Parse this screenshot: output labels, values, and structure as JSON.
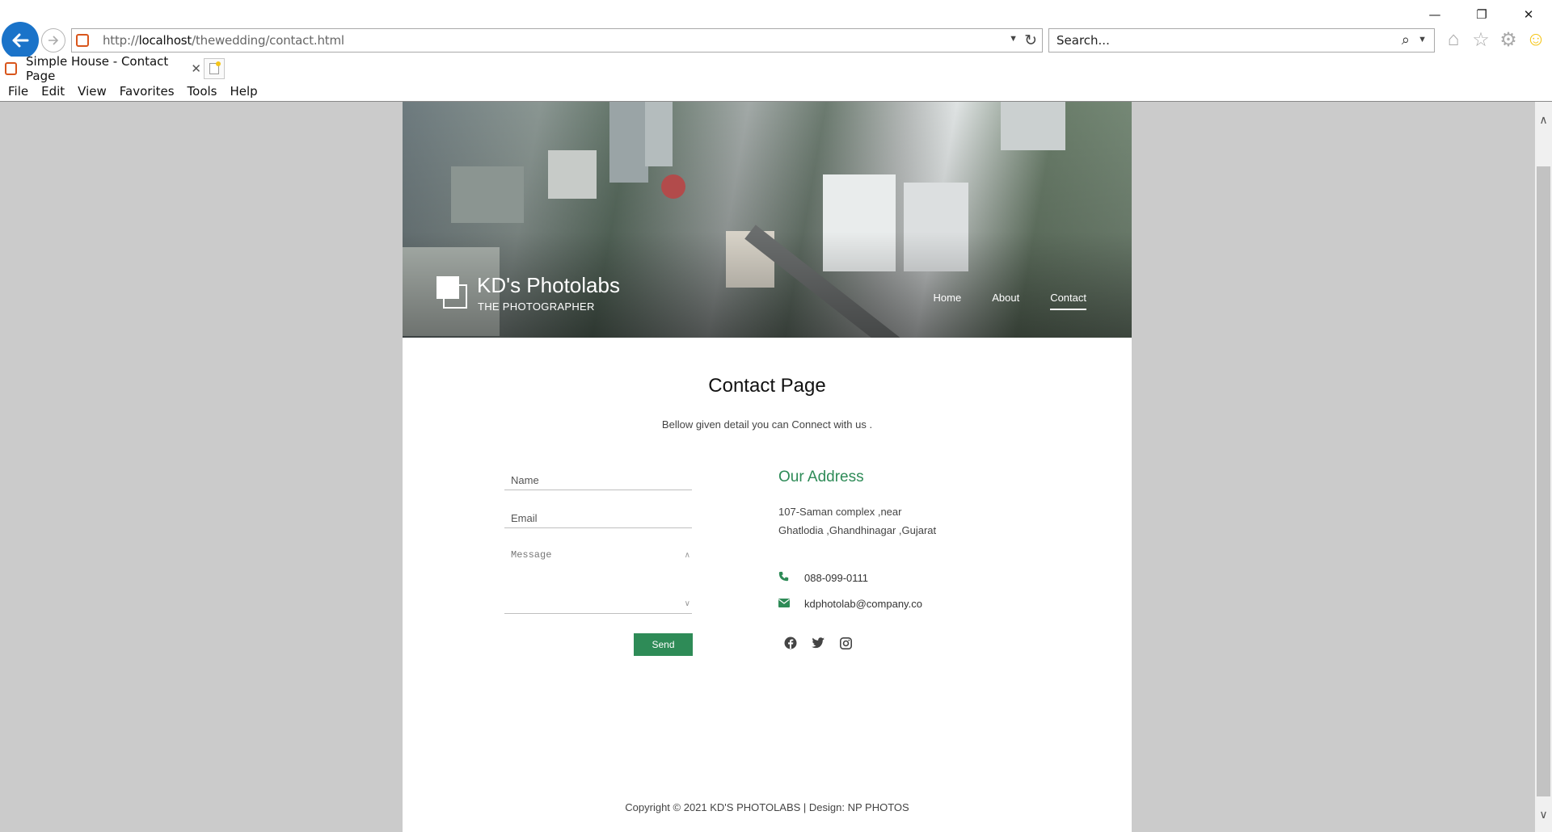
{
  "browser": {
    "url_prefix": "http://",
    "url_host": "localhost",
    "url_path": "/thewedding/contact.html",
    "search_placeholder": "Search...",
    "tab_title": "Simple House - Contact Page",
    "menu": [
      "File",
      "Edit",
      "View",
      "Favorites",
      "Tools",
      "Help"
    ]
  },
  "site": {
    "brand_name": "KD's Photolabs",
    "brand_tagline": "THE PHOTOGRAPHER",
    "nav": [
      "Home",
      "About",
      "Contact"
    ],
    "active_nav": "Contact"
  },
  "contact": {
    "title": "Contact Page",
    "subtitle": "Bellow given detail you can Connect with us .",
    "form": {
      "name_placeholder": "Name",
      "email_placeholder": "Email",
      "message_placeholder": "Message",
      "send_label": "Send"
    },
    "address": {
      "heading": "Our Address",
      "line1": "107-Saman complex ,near",
      "line2": "Ghatlodia ,Ghandhinagar ,Gujarat",
      "phone": "088-099-0111",
      "email": "kdphotolab@company.co"
    }
  },
  "footer": {
    "text": "Copyright © 2021 KD'S PHOTOLABS | Design: NP PHOTOS"
  },
  "colors": {
    "accent": "#2e8b57",
    "browser_back": "#1a73c9",
    "viewport_bg": "#cbcbcb"
  }
}
